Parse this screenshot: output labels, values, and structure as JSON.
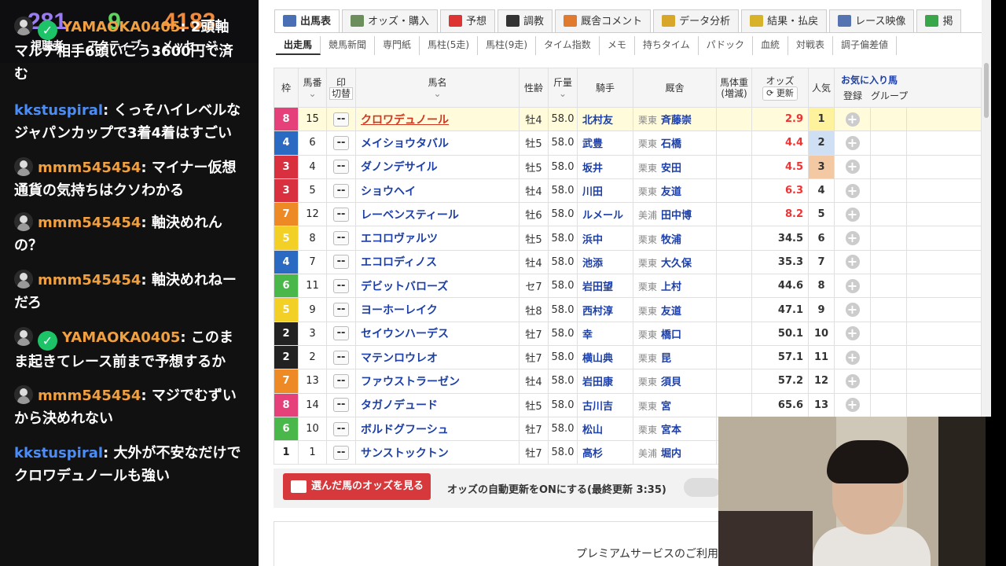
{
  "stats": [
    {
      "value": "281",
      "label": "視聴者",
      "color": "#9b7cf0"
    },
    {
      "value": "9",
      "label": "アクティブ",
      "color": "#5fd35f"
    },
    {
      "value": "4183",
      "label": "メッセージ",
      "color": "#f08a3c"
    }
  ],
  "chat": [
    {
      "user": "YAMAOKA0405",
      "color": "#f0a040",
      "avatar": true,
      "verified": true,
      "line1": "2頭軸",
      "line2": "マルチ相手6頭いこう3600円で済",
      "line3": "む"
    },
    {
      "user": "kkstuspiral",
      "color": "#4b8cf5",
      "avatar": false,
      "verified": false,
      "line1": "くっそハイレベルな",
      "line2": "ジャパンカップで3着4着はすごい",
      "line3": ""
    },
    {
      "user": "mmm545454",
      "color": "#f0a040",
      "avatar": true,
      "verified": false,
      "line1": "マイナー仮想",
      "line2": "通貨の気持ちはクソわかる",
      "line3": ""
    },
    {
      "user": "mmm545454",
      "color": "#f0a040",
      "avatar": true,
      "verified": false,
      "line1": "軸決めれん",
      "line2": "の？",
      "line3": ""
    },
    {
      "user": "mmm545454",
      "color": "#f0a040",
      "avatar": true,
      "verified": false,
      "line1": "軸決めれねー",
      "line2": "だろ",
      "line3": ""
    },
    {
      "user": "YAMAOKA0405",
      "color": "#f0a040",
      "avatar": true,
      "verified": true,
      "line1": "このま",
      "line2": "ま起きてレース前まで予想するか",
      "line3": ""
    },
    {
      "user": "mmm545454",
      "color": "#f0a040",
      "avatar": true,
      "verified": false,
      "line1": "マジでむずい",
      "line2": "から決めれない",
      "line3": ""
    },
    {
      "user": "kkstuspiral",
      "color": "#4b8cf5",
      "avatar": false,
      "verified": false,
      "line1": "大外が不安なだけで",
      "line2": "クロワデュノールも強い",
      "line3": ""
    }
  ],
  "tabs": [
    {
      "label": "出馬表",
      "icon": "table-icon",
      "color": "#4a6fb5",
      "active": true
    },
    {
      "label": "オッズ・購入",
      "icon": "odds-icon",
      "color": "#6b8e5a",
      "active": false
    },
    {
      "label": "予想",
      "icon": "target-icon",
      "color": "#d33",
      "active": false
    },
    {
      "label": "調教",
      "icon": "stopwatch-icon",
      "color": "#333",
      "active": false
    },
    {
      "label": "厩舎コメント",
      "icon": "house-icon",
      "color": "#e07a2e",
      "active": false
    },
    {
      "label": "データ分析",
      "icon": "bar-chart-icon",
      "color": "#d8a72a",
      "active": false
    },
    {
      "label": "結果・払戻",
      "icon": "coins-icon",
      "color": "#d8b32a",
      "active": false
    },
    {
      "label": "レース映像",
      "icon": "video-icon",
      "color": "#5573b0",
      "active": false
    },
    {
      "label": "掲",
      "icon": "chat-icon",
      "color": "#3aa64a",
      "active": false
    }
  ],
  "subtabs": [
    "出走馬",
    "競馬新聞",
    "専門紙",
    "馬柱(5走)",
    "馬柱(9走)",
    "タイム指数",
    "メモ",
    "持ちタイム",
    "パドック",
    "血統",
    "対戦表",
    "調子偏差値"
  ],
  "headers": {
    "waku": "枠",
    "umaban": "馬番",
    "mark": "印",
    "mark_sub": "切替",
    "name": "馬名",
    "age": "性齢",
    "kin": "斤量",
    "jockey": "騎手",
    "trainer": "厩舎",
    "weight": "馬体重",
    "weight_sub": "(増減)",
    "odds": "オッズ",
    "odds_btn": "更新",
    "pop": "人気",
    "fav": "お気に入り馬",
    "fav_reg": "登録",
    "fav_grp": "グループ"
  },
  "rows": [
    {
      "waku": "8",
      "wc": "#e6407a",
      "ban": "15",
      "name": "クロワデュノール",
      "age": "牡4",
      "kin": "58.0",
      "jockey": "北村友",
      "area": "栗東",
      "trainer": "斉藤崇",
      "odds": "2.9",
      "red": true,
      "pop": "1",
      "pc": "#fff29c"
    },
    {
      "waku": "4",
      "wc": "#2a6ac2",
      "ban": "6",
      "name": "メイショウタバル",
      "age": "牡5",
      "kin": "58.0",
      "jockey": "武豊",
      "area": "栗東",
      "trainer": "石橋",
      "odds": "4.4",
      "red": true,
      "pop": "2",
      "pc": "#cfe0f5"
    },
    {
      "waku": "3",
      "wc": "#d93040",
      "ban": "4",
      "name": "ダノンデサイル",
      "age": "牡5",
      "kin": "58.0",
      "jockey": "坂井",
      "area": "栗東",
      "trainer": "安田",
      "odds": "4.5",
      "red": true,
      "pop": "3",
      "pc": "#f3c9a3"
    },
    {
      "waku": "3",
      "wc": "#d93040",
      "ban": "5",
      "name": "ショウヘイ",
      "age": "牡4",
      "kin": "58.0",
      "jockey": "川田",
      "area": "栗東",
      "trainer": "友道",
      "odds": "6.3",
      "red": true,
      "pop": "4",
      "pc": ""
    },
    {
      "waku": "7",
      "wc": "#ed8a25",
      "ban": "12",
      "name": "レーベンスティール",
      "age": "牡6",
      "kin": "58.0",
      "jockey": "ルメール",
      "area": "美浦",
      "trainer": "田中博",
      "odds": "8.2",
      "red": true,
      "pop": "5",
      "pc": ""
    },
    {
      "waku": "5",
      "wc": "#f2d026",
      "ban": "8",
      "name": "エコロヴァルツ",
      "age": "牡5",
      "kin": "58.0",
      "jockey": "浜中",
      "area": "栗東",
      "trainer": "牧浦",
      "odds": "34.5",
      "red": false,
      "pop": "6",
      "pc": ""
    },
    {
      "waku": "4",
      "wc": "#2a6ac2",
      "ban": "7",
      "name": "エコロディノス",
      "age": "牡4",
      "kin": "58.0",
      "jockey": "池添",
      "area": "栗東",
      "trainer": "大久保",
      "odds": "35.3",
      "red": false,
      "pop": "7",
      "pc": ""
    },
    {
      "waku": "6",
      "wc": "#4ab74a",
      "ban": "11",
      "name": "デビットバローズ",
      "age": "セ7",
      "kin": "58.0",
      "jockey": "岩田望",
      "area": "栗東",
      "trainer": "上村",
      "odds": "44.6",
      "red": false,
      "pop": "8",
      "pc": ""
    },
    {
      "waku": "5",
      "wc": "#f2d026",
      "ban": "9",
      "name": "ヨーホーレイク",
      "age": "牡8",
      "kin": "58.0",
      "jockey": "西村淳",
      "area": "栗東",
      "trainer": "友道",
      "odds": "47.1",
      "red": false,
      "pop": "9",
      "pc": ""
    },
    {
      "waku": "2",
      "wc": "#222222",
      "ban": "3",
      "name": "セイウンハーデス",
      "age": "牡7",
      "kin": "58.0",
      "jockey": "幸",
      "area": "栗東",
      "trainer": "橋口",
      "odds": "50.1",
      "red": false,
      "pop": "10",
      "pc": ""
    },
    {
      "waku": "2",
      "wc": "#222222",
      "ban": "2",
      "name": "マテンロウレオ",
      "age": "牡7",
      "kin": "58.0",
      "jockey": "横山典",
      "area": "栗東",
      "trainer": "昆",
      "odds": "57.1",
      "red": false,
      "pop": "11",
      "pc": ""
    },
    {
      "waku": "7",
      "wc": "#ed8a25",
      "ban": "13",
      "name": "ファウストラーゼン",
      "age": "牡4",
      "kin": "58.0",
      "jockey": "岩田康",
      "area": "栗東",
      "trainer": "須貝",
      "odds": "57.2",
      "red": false,
      "pop": "12",
      "pc": ""
    },
    {
      "waku": "8",
      "wc": "#e6407a",
      "ban": "14",
      "name": "タガノデュード",
      "age": "牡5",
      "kin": "58.0",
      "jockey": "古川吉",
      "area": "栗東",
      "trainer": "宮",
      "odds": "65.6",
      "red": false,
      "pop": "13",
      "pc": ""
    },
    {
      "waku": "6",
      "wc": "#4ab74a",
      "ban": "10",
      "name": "ボルドグフーシュ",
      "age": "牡7",
      "kin": "58.0",
      "jockey": "松山",
      "area": "栗東",
      "trainer": "宮本",
      "odds": "",
      "red": false,
      "pop": "",
      "pc": ""
    },
    {
      "waku": "1",
      "wc": "#ffffff",
      "ban": "1",
      "name": "サンストックトン",
      "age": "牡7",
      "kin": "58.0",
      "jockey": "高杉",
      "area": "美浦",
      "trainer": "堀内",
      "odds": "",
      "red": false,
      "pop": "",
      "pc": ""
    }
  ],
  "bottom": {
    "btn": "選んだ馬のオッズを見る",
    "auto": "オッズの自動更新をONにする(最終更新 3:35)"
  },
  "premium": "プレミアムサービスのご利用"
}
